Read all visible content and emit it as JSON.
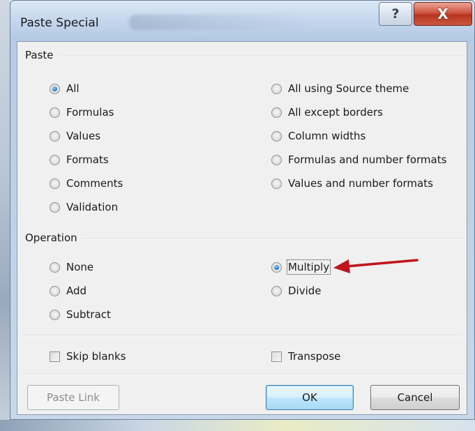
{
  "window": {
    "title": "Paste Special",
    "help_glyph": "?",
    "close_glyph": "X"
  },
  "paste_group": {
    "label": "Paste",
    "options_left": [
      {
        "label": "All",
        "checked": true
      },
      {
        "label": "Formulas",
        "checked": false
      },
      {
        "label": "Values",
        "checked": false
      },
      {
        "label": "Formats",
        "checked": false
      },
      {
        "label": "Comments",
        "checked": false
      },
      {
        "label": "Validation",
        "checked": false
      }
    ],
    "options_right": [
      {
        "label": "All using Source theme",
        "checked": false
      },
      {
        "label": "All except borders",
        "checked": false
      },
      {
        "label": "Column widths",
        "checked": false
      },
      {
        "label": "Formulas and number formats",
        "checked": false
      },
      {
        "label": "Values and number formats",
        "checked": false
      }
    ]
  },
  "operation_group": {
    "label": "Operation",
    "options_left": [
      {
        "label": "None",
        "checked": false
      },
      {
        "label": "Add",
        "checked": false
      },
      {
        "label": "Subtract",
        "checked": false
      }
    ],
    "options_right": [
      {
        "label": "Multiply",
        "checked": true
      },
      {
        "label": "Divide",
        "checked": false
      }
    ]
  },
  "checkboxes": {
    "skip_blanks": {
      "label": "Skip blanks",
      "checked": false
    },
    "transpose": {
      "label": "Transpose",
      "checked": false
    }
  },
  "buttons": {
    "paste_link": "Paste Link",
    "ok": "OK",
    "cancel": "Cancel"
  },
  "annotation": {
    "arrow_color": "#c0141c",
    "arrow_points_to": "Multiply"
  },
  "colors": {
    "dialog_background": "#f0f0f0",
    "title_bar": "#c3d5ec",
    "close_button": "#c9432e",
    "selected_radio": "#2a7fd0"
  }
}
